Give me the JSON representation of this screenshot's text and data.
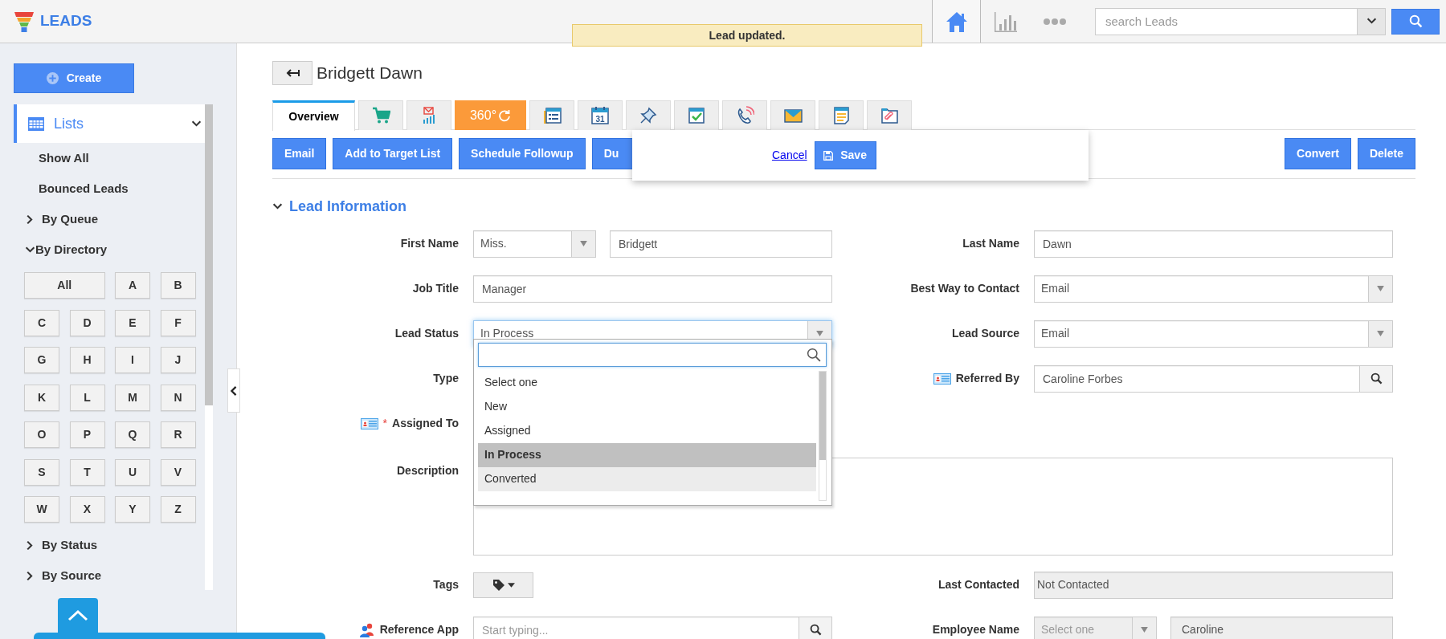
{
  "app": {
    "title": "LEADS"
  },
  "toast": {
    "text": "Lead updated."
  },
  "topbar": {
    "nav": [
      {
        "kind": "home",
        "selected": true
      },
      {
        "kind": "chart",
        "selected": false
      },
      {
        "kind": "more",
        "selected": false
      }
    ],
    "search": {
      "placeholder": "search Leads"
    }
  },
  "sidebar": {
    "create": "Create",
    "lists": {
      "label": "Lists",
      "expanded": true
    },
    "items": [
      {
        "label": "Show All"
      },
      {
        "label": "Bounced Leads"
      }
    ],
    "groups": [
      {
        "label": "By Queue",
        "expanded": false
      },
      {
        "label": "By Directory",
        "expanded": true,
        "letters": [
          "All",
          "A",
          "B",
          "C",
          "D",
          "E",
          "F",
          "G",
          "H",
          "I",
          "J",
          "K",
          "L",
          "M",
          "N",
          "O",
          "P",
          "Q",
          "R",
          "S",
          "T",
          "U",
          "V",
          "W",
          "X",
          "Y",
          "Z"
        ]
      },
      {
        "label": "By Status",
        "expanded": false
      },
      {
        "label": "By Source",
        "expanded": false
      }
    ]
  },
  "record": {
    "title": "Bridgett Dawn"
  },
  "tabs": [
    {
      "kind": "text",
      "label": "Overview",
      "selected": true
    },
    {
      "kind": "cart",
      "selected": false
    },
    {
      "kind": "mail-chart",
      "selected": false
    },
    {
      "kind": "panorama",
      "label": "360°",
      "selected": false
    },
    {
      "kind": "form",
      "selected": false
    },
    {
      "kind": "calendar",
      "label": "31",
      "selected": false
    },
    {
      "kind": "pin",
      "selected": false
    },
    {
      "kind": "check-calendar",
      "selected": false
    },
    {
      "kind": "phone",
      "selected": false
    },
    {
      "kind": "envelope",
      "selected": false
    },
    {
      "kind": "note",
      "selected": false
    },
    {
      "kind": "attachment",
      "selected": false
    }
  ],
  "actions": [
    "Email",
    "Add to Target List",
    "Schedule Followup",
    "Du"
  ],
  "actions_right": [
    "Convert",
    "Delete"
  ],
  "popover": {
    "cancel": "Cancel",
    "save": "Save"
  },
  "section": {
    "title": "Lead Information",
    "expanded": true
  },
  "rows": [
    {
      "left": {
        "label": "First Name",
        "kind": "salutation",
        "select": "Miss.",
        "value": "Bridgett"
      },
      "right": {
        "label": "Last Name",
        "kind": "text",
        "value": "Dawn"
      }
    },
    {
      "left": {
        "label": "Job Title",
        "kind": "text",
        "value": "Manager"
      },
      "right": {
        "label": "Best Way to Contact",
        "kind": "select",
        "value": "Email"
      }
    },
    {
      "left": {
        "label": "Lead Status",
        "kind": "select",
        "value": "In Process",
        "open": true,
        "options": [
          {
            "label": "Select one",
            "selected": false,
            "hovered": false
          },
          {
            "label": "New",
            "selected": false,
            "hovered": false
          },
          {
            "label": "Assigned",
            "selected": false,
            "hovered": false
          },
          {
            "label": "In Process",
            "selected": true,
            "hovered": false
          },
          {
            "label": "Converted",
            "selected": false,
            "hovered": true
          }
        ]
      },
      "right": {
        "label": "Lead Source",
        "kind": "select",
        "value": "Email"
      }
    },
    {
      "left": {
        "label": "Type",
        "kind": "covered"
      },
      "right": {
        "label": "Referred By",
        "kind": "lookup",
        "value": "Caroline Forbes",
        "card_icon": true
      }
    },
    {
      "left": {
        "label": "Assigned To",
        "kind": "covered",
        "required": "*",
        "card_icon": true
      }
    },
    {
      "left": {
        "label": "Description",
        "kind": "textarea"
      }
    },
    {
      "left": {
        "label": "Tags",
        "kind": "tags"
      },
      "right": {
        "label": "Last Contacted",
        "kind": "readonly",
        "value": "Not Contacted"
      }
    },
    {
      "left": {
        "label": "Reference App",
        "kind": "lookup",
        "placeholder": "Start typing...",
        "people_icon": true
      },
      "right": {
        "label": "Employee Name",
        "kind": "readonly-salutation",
        "select": "Select one",
        "value": "Caroline"
      }
    }
  ]
}
